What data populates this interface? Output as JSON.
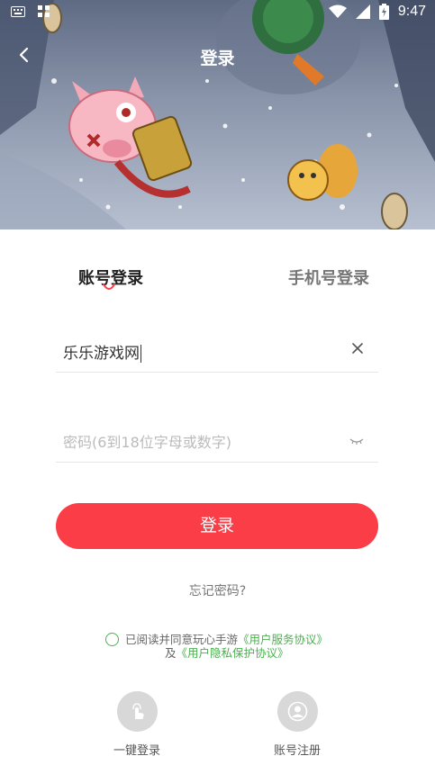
{
  "status_bar": {
    "time": "9:47",
    "left_icons": [
      "keyboard-icon",
      "app-grid-icon"
    ],
    "right_icons": [
      "wifi-icon",
      "signal-icon",
      "battery-charging-icon"
    ]
  },
  "header": {
    "title": "登录",
    "back_icon": "chevron-left-icon"
  },
  "tabs": [
    {
      "label": "账号登录",
      "active": true
    },
    {
      "label": "手机号登录",
      "active": false
    }
  ],
  "username_field": {
    "value": "乐乐游戏网",
    "clear_icon": "close-icon"
  },
  "password_field": {
    "placeholder": "密码(6到18位字母或数字)",
    "toggle_icon": "eye-closed-icon"
  },
  "login_button": {
    "label": "登录"
  },
  "forgot_password": {
    "label": "忘记密码?"
  },
  "agreement": {
    "prefix": "已阅读并同意玩心手游",
    "service_link": "《用户服务协议》",
    "conjunction": "及",
    "privacy_link": "《用户隐私保护协议》"
  },
  "quick_actions": [
    {
      "label": "一键登录",
      "icon": "touch-hand-icon"
    },
    {
      "label": "账号注册",
      "icon": "user-register-icon"
    }
  ],
  "colors": {
    "primary": "#fb3d48",
    "link": "#4caf50",
    "muted_text": "#777777"
  }
}
